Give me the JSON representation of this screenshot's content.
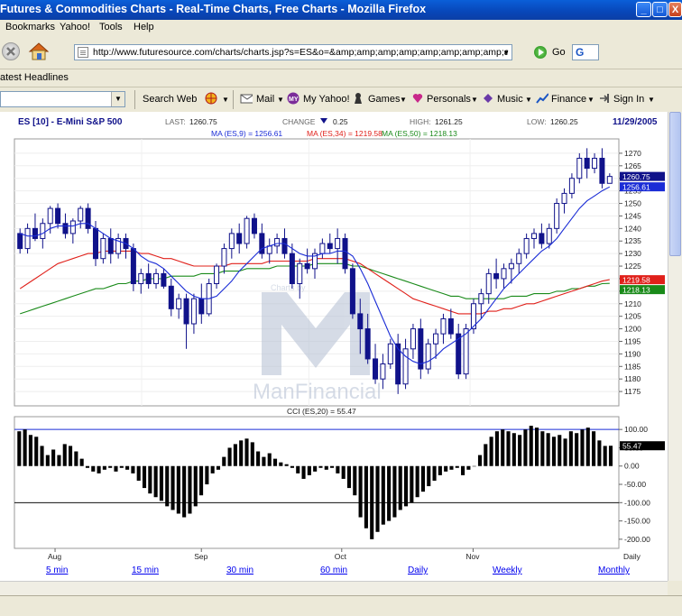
{
  "window": {
    "title": "Futures & Commodities Charts - Real-Time Charts, Free Charts - Mozilla Firefox",
    "minimize": "_",
    "maximize": "□",
    "close": "X"
  },
  "menu": {
    "items": [
      "Bookmarks",
      "Yahoo!",
      "Tools",
      "Help"
    ]
  },
  "navigation": {
    "url": "http://www.futuresource.com/charts/charts.jsp?s=ES&o=&amp;amp;amp;amp;amp;amp;amp;amp;amp;a=D",
    "go_label": "Go",
    "search_engine": "G"
  },
  "bookmarks_bar": {
    "headlines": "atest Headlines"
  },
  "yahoo_toolbar": {
    "items": [
      "Search Web",
      "Mail",
      "My Yahoo!",
      "Games",
      "Personals",
      "Music",
      "Finance",
      "Sign In"
    ]
  },
  "chart_header": {
    "symbol": "ES [10] - E-Mini S&P 500",
    "last_label": "LAST:",
    "last_value": "1260.75",
    "change_label": "CHANGE",
    "change_value": "0.25",
    "high_label": "HIGH:",
    "high_value": "1261.25",
    "low_label": "LOW:",
    "low_value": "1260.25",
    "date": "11/29/2005",
    "ma9": "MA (ES,9) = 1256.61",
    "ma34": "MA (ES,34) = 1219.58",
    "ma50": "MA (ES,50) = 1218.13",
    "watermark_top": "Charts by",
    "watermark": "ManFinancial",
    "cci_title": "CCI (ES,20) = 55.47",
    "period_label": "Daily"
  },
  "links": [
    "5 min",
    "15 min",
    "30 min",
    "60 min",
    "Daily",
    "Weekly",
    "Monthly"
  ],
  "colors": {
    "ma9": "#1a2cd6",
    "ma34": "#e0201a",
    "ma50": "#198a19",
    "candle": "#10128a",
    "watermark": "#b4bfd3"
  },
  "chart_data": [
    {
      "type": "candlestick",
      "title": "ES [10] - E-Mini S&P 500",
      "x_labels": [
        "Aug",
        "Sep",
        "Oct",
        "Nov"
      ],
      "ylim": [
        1170,
        1275
      ],
      "y_ticks": [
        1175,
        1180,
        1185,
        1190,
        1195,
        1200,
        1205,
        1210,
        1215,
        1220,
        1225,
        1230,
        1235,
        1240,
        1245,
        1250,
        1255,
        1260,
        1265,
        1270
      ],
      "value_tags": [
        {
          "value": 1260.75,
          "label": "1260.75",
          "color": "#10128a"
        },
        {
          "value": 1256.61,
          "label": "1256.61",
          "color": "#1a2cd6"
        },
        {
          "value": 1219.58,
          "label": "1219.58",
          "color": "#e0201a"
        },
        {
          "value": 1218.13,
          "label": "1218.13",
          "color": "#198a19"
        }
      ],
      "candles": [
        {
          "o": 1238,
          "h": 1240,
          "l": 1230,
          "c": 1232
        },
        {
          "o": 1232,
          "h": 1242,
          "l": 1230,
          "c": 1240
        },
        {
          "o": 1240,
          "h": 1246,
          "l": 1235,
          "c": 1236
        },
        {
          "o": 1236,
          "h": 1244,
          "l": 1232,
          "c": 1242
        },
        {
          "o": 1242,
          "h": 1249,
          "l": 1238,
          "c": 1248
        },
        {
          "o": 1248,
          "h": 1250,
          "l": 1240,
          "c": 1242
        },
        {
          "o": 1242,
          "h": 1246,
          "l": 1236,
          "c": 1238
        },
        {
          "o": 1238,
          "h": 1244,
          "l": 1234,
          "c": 1243
        },
        {
          "o": 1243,
          "h": 1249,
          "l": 1240,
          "c": 1248
        },
        {
          "o": 1248,
          "h": 1250,
          "l": 1238,
          "c": 1240
        },
        {
          "o": 1240,
          "h": 1243,
          "l": 1225,
          "c": 1228
        },
        {
          "o": 1228,
          "h": 1238,
          "l": 1226,
          "c": 1236
        },
        {
          "o": 1236,
          "h": 1240,
          "l": 1226,
          "c": 1230
        },
        {
          "o": 1230,
          "h": 1238,
          "l": 1228,
          "c": 1236
        },
        {
          "o": 1236,
          "h": 1238,
          "l": 1228,
          "c": 1232
        },
        {
          "o": 1232,
          "h": 1234,
          "l": 1215,
          "c": 1218
        },
        {
          "o": 1218,
          "h": 1224,
          "l": 1214,
          "c": 1222
        },
        {
          "o": 1222,
          "h": 1226,
          "l": 1216,
          "c": 1218
        },
        {
          "o": 1218,
          "h": 1224,
          "l": 1216,
          "c": 1222
        },
        {
          "o": 1222,
          "h": 1224,
          "l": 1216,
          "c": 1217
        },
        {
          "o": 1217,
          "h": 1220,
          "l": 1205,
          "c": 1208
        },
        {
          "o": 1208,
          "h": 1214,
          "l": 1204,
          "c": 1212
        },
        {
          "o": 1212,
          "h": 1214,
          "l": 1192,
          "c": 1202
        },
        {
          "o": 1202,
          "h": 1214,
          "l": 1198,
          "c": 1212
        },
        {
          "o": 1212,
          "h": 1218,
          "l": 1202,
          "c": 1206
        },
        {
          "o": 1206,
          "h": 1220,
          "l": 1205,
          "c": 1218
        },
        {
          "o": 1218,
          "h": 1226,
          "l": 1216,
          "c": 1225
        },
        {
          "o": 1225,
          "h": 1234,
          "l": 1222,
          "c": 1232
        },
        {
          "o": 1232,
          "h": 1240,
          "l": 1228,
          "c": 1238
        },
        {
          "o": 1238,
          "h": 1242,
          "l": 1230,
          "c": 1234
        },
        {
          "o": 1234,
          "h": 1245,
          "l": 1232,
          "c": 1244
        },
        {
          "o": 1244,
          "h": 1246,
          "l": 1236,
          "c": 1238
        },
        {
          "o": 1238,
          "h": 1242,
          "l": 1228,
          "c": 1230
        },
        {
          "o": 1230,
          "h": 1236,
          "l": 1226,
          "c": 1233
        },
        {
          "o": 1233,
          "h": 1238,
          "l": 1230,
          "c": 1236
        },
        {
          "o": 1236,
          "h": 1240,
          "l": 1228,
          "c": 1230
        },
        {
          "o": 1230,
          "h": 1234,
          "l": 1216,
          "c": 1218
        },
        {
          "o": 1218,
          "h": 1228,
          "l": 1212,
          "c": 1226
        },
        {
          "o": 1226,
          "h": 1232,
          "l": 1222,
          "c": 1224
        },
        {
          "o": 1224,
          "h": 1232,
          "l": 1220,
          "c": 1230
        },
        {
          "o": 1230,
          "h": 1236,
          "l": 1228,
          "c": 1234
        },
        {
          "o": 1234,
          "h": 1238,
          "l": 1230,
          "c": 1232
        },
        {
          "o": 1232,
          "h": 1240,
          "l": 1226,
          "c": 1236
        },
        {
          "o": 1236,
          "h": 1238,
          "l": 1222,
          "c": 1224
        },
        {
          "o": 1224,
          "h": 1226,
          "l": 1204,
          "c": 1206
        },
        {
          "o": 1206,
          "h": 1212,
          "l": 1190,
          "c": 1200
        },
        {
          "o": 1200,
          "h": 1206,
          "l": 1186,
          "c": 1188
        },
        {
          "o": 1188,
          "h": 1194,
          "l": 1178,
          "c": 1180
        },
        {
          "o": 1180,
          "h": 1190,
          "l": 1176,
          "c": 1186
        },
        {
          "o": 1186,
          "h": 1196,
          "l": 1184,
          "c": 1194
        },
        {
          "o": 1194,
          "h": 1198,
          "l": 1174,
          "c": 1178
        },
        {
          "o": 1178,
          "h": 1196,
          "l": 1176,
          "c": 1192
        },
        {
          "o": 1192,
          "h": 1202,
          "l": 1188,
          "c": 1200
        },
        {
          "o": 1200,
          "h": 1204,
          "l": 1180,
          "c": 1184
        },
        {
          "o": 1184,
          "h": 1196,
          "l": 1182,
          "c": 1194
        },
        {
          "o": 1194,
          "h": 1200,
          "l": 1188,
          "c": 1198
        },
        {
          "o": 1198,
          "h": 1206,
          "l": 1194,
          "c": 1204
        },
        {
          "o": 1204,
          "h": 1208,
          "l": 1196,
          "c": 1198
        },
        {
          "o": 1198,
          "h": 1202,
          "l": 1180,
          "c": 1182
        },
        {
          "o": 1182,
          "h": 1202,
          "l": 1180,
          "c": 1200
        },
        {
          "o": 1200,
          "h": 1212,
          "l": 1198,
          "c": 1210
        },
        {
          "o": 1210,
          "h": 1216,
          "l": 1204,
          "c": 1214
        },
        {
          "o": 1214,
          "h": 1224,
          "l": 1210,
          "c": 1222
        },
        {
          "o": 1222,
          "h": 1228,
          "l": 1216,
          "c": 1220
        },
        {
          "o": 1220,
          "h": 1226,
          "l": 1216,
          "c": 1224
        },
        {
          "o": 1224,
          "h": 1228,
          "l": 1218,
          "c": 1226
        },
        {
          "o": 1226,
          "h": 1232,
          "l": 1222,
          "c": 1230
        },
        {
          "o": 1230,
          "h": 1238,
          "l": 1228,
          "c": 1236
        },
        {
          "o": 1236,
          "h": 1240,
          "l": 1232,
          "c": 1238
        },
        {
          "o": 1238,
          "h": 1242,
          "l": 1232,
          "c": 1234
        },
        {
          "o": 1234,
          "h": 1242,
          "l": 1232,
          "c": 1240
        },
        {
          "o": 1240,
          "h": 1252,
          "l": 1238,
          "c": 1250
        },
        {
          "o": 1250,
          "h": 1256,
          "l": 1246,
          "c": 1254
        },
        {
          "o": 1254,
          "h": 1262,
          "l": 1252,
          "c": 1260
        },
        {
          "o": 1260,
          "h": 1270,
          "l": 1258,
          "c": 1268
        },
        {
          "o": 1268,
          "h": 1272,
          "l": 1260,
          "c": 1264
        },
        {
          "o": 1264,
          "h": 1270,
          "l": 1262,
          "c": 1268
        },
        {
          "o": 1268,
          "h": 1272,
          "l": 1256,
          "c": 1258
        },
        {
          "o": 1258,
          "h": 1262,
          "l": 1258,
          "c": 1260.75
        }
      ],
      "ma9": [
        1238,
        1237,
        1237,
        1238,
        1240,
        1241,
        1241,
        1241,
        1242,
        1242,
        1240,
        1238,
        1236,
        1235,
        1234,
        1232,
        1229,
        1227,
        1226,
        1224,
        1221,
        1218,
        1215,
        1213,
        1212,
        1212,
        1213,
        1216,
        1219,
        1223,
        1226,
        1229,
        1232,
        1233,
        1234,
        1234,
        1232,
        1230,
        1229,
        1229,
        1230,
        1230,
        1231,
        1231,
        1229,
        1224,
        1218,
        1211,
        1204,
        1197,
        1192,
        1189,
        1187,
        1186,
        1187,
        1189,
        1192,
        1194,
        1196,
        1198,
        1201,
        1204,
        1208,
        1212,
        1216,
        1219,
        1222,
        1225,
        1228,
        1231,
        1233,
        1236,
        1240,
        1244,
        1248,
        1251,
        1253,
        1255,
        1256.6
      ],
      "ma34": [
        1216,
        1218,
        1220,
        1222,
        1224,
        1226,
        1227,
        1228,
        1229,
        1230,
        1230,
        1231,
        1231,
        1231,
        1231,
        1231,
        1230,
        1230,
        1229,
        1228,
        1228,
        1227,
        1226,
        1225,
        1225,
        1225,
        1225,
        1225,
        1226,
        1226,
        1226,
        1226,
        1226,
        1227,
        1227,
        1227,
        1227,
        1227,
        1227,
        1228,
        1228,
        1228,
        1228,
        1228,
        1227,
        1226,
        1224,
        1222,
        1220,
        1218,
        1216,
        1214,
        1212,
        1211,
        1210,
        1209,
        1208,
        1207,
        1206,
        1206,
        1206,
        1206,
        1207,
        1207,
        1208,
        1208,
        1209,
        1210,
        1210,
        1211,
        1212,
        1213,
        1214,
        1215,
        1216,
        1217,
        1218,
        1219,
        1219.6
      ],
      "ma50": [
        1206,
        1207,
        1208,
        1209,
        1210,
        1211,
        1212,
        1213,
        1214,
        1215,
        1216,
        1216,
        1217,
        1218,
        1218,
        1219,
        1219,
        1220,
        1220,
        1220,
        1221,
        1221,
        1221,
        1221,
        1222,
        1222,
        1222,
        1223,
        1223,
        1223,
        1224,
        1224,
        1224,
        1224,
        1225,
        1225,
        1225,
        1225,
        1225,
        1226,
        1226,
        1226,
        1226,
        1226,
        1225,
        1225,
        1224,
        1223,
        1222,
        1221,
        1220,
        1219,
        1218,
        1217,
        1216,
        1215,
        1214,
        1213,
        1213,
        1212,
        1212,
        1212,
        1212,
        1212,
        1212,
        1213,
        1213,
        1213,
        1214,
        1214,
        1214,
        1215,
        1215,
        1216,
        1216,
        1217,
        1217,
        1218,
        1218.1
      ]
    },
    {
      "type": "bar",
      "title": "CCI (ES,20) = 55.47",
      "ylim": [
        -220,
        130
      ],
      "y_ticks": [
        100,
        50,
        0,
        -50,
        -100,
        -150,
        -200
      ],
      "y_tick_labels": [
        "100.00",
        "50.00",
        "0.00",
        "-50.00",
        "-100.00",
        "-150.00",
        "-200.00"
      ],
      "value_tag": {
        "value": 55.47,
        "label": "55.47"
      },
      "reference_lines": [
        100,
        -100
      ],
      "values": [
        95,
        100,
        85,
        80,
        55,
        30,
        45,
        30,
        60,
        55,
        40,
        20,
        -5,
        -15,
        -20,
        -10,
        -5,
        -15,
        -5,
        -10,
        -20,
        -40,
        -60,
        -75,
        -85,
        -95,
        -110,
        -120,
        -130,
        -140,
        -130,
        -110,
        -80,
        -50,
        -20,
        -10,
        25,
        50,
        60,
        70,
        75,
        65,
        40,
        25,
        35,
        20,
        10,
        5,
        -5,
        -20,
        -35,
        -25,
        -15,
        -5,
        -10,
        -5,
        -20,
        -35,
        -60,
        -80,
        -140,
        -170,
        -200,
        -180,
        -160,
        -150,
        -140,
        -120,
        -110,
        -100,
        -85,
        -70,
        -55,
        -40,
        -25,
        -15,
        -10,
        -5,
        -25,
        -10,
        0,
        30,
        60,
        80,
        95,
        100,
        95,
        90,
        85,
        100,
        110,
        105,
        95,
        90,
        80,
        85,
        75,
        95,
        90,
        100,
        105,
        95,
        70,
        55,
        55.47
      ]
    }
  ]
}
